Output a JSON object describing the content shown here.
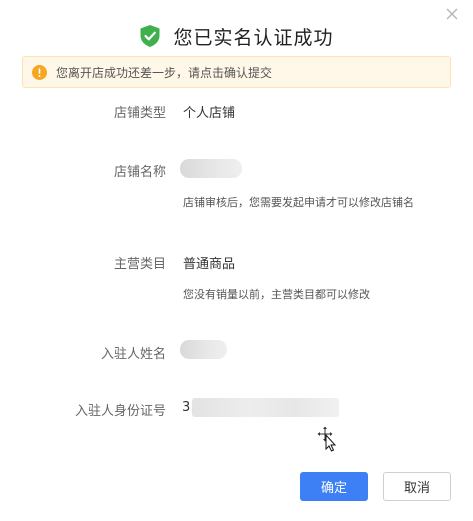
{
  "dialog": {
    "title": "您已实名认证成功",
    "close_icon": "close-icon",
    "success_icon": "shield-check-icon",
    "colors": {
      "success": "#3fb04b",
      "primary": "#3d7ff5",
      "warning": "#f5a623",
      "notice_bg": "#fff7e8"
    }
  },
  "notice": {
    "icon": "warning-icon",
    "text": "您离开店成功还差一步，请点击确认提交"
  },
  "fields": {
    "shop_type": {
      "label": "店铺类型",
      "value": "个人店铺"
    },
    "shop_name": {
      "label": "店铺名称",
      "hint": "店铺审核后，您需要发起申请才可以修改店铺名"
    },
    "main_category": {
      "label": "主营类目",
      "value": "普通商品",
      "hint": "您没有销量以前，主营类目都可以修改"
    },
    "settler_name": {
      "label": "入驻人姓名"
    },
    "settler_id": {
      "label": "入驻人身份证号",
      "value_prefix": "3"
    }
  },
  "footer": {
    "confirm_label": "确定",
    "cancel_label": "取消"
  }
}
